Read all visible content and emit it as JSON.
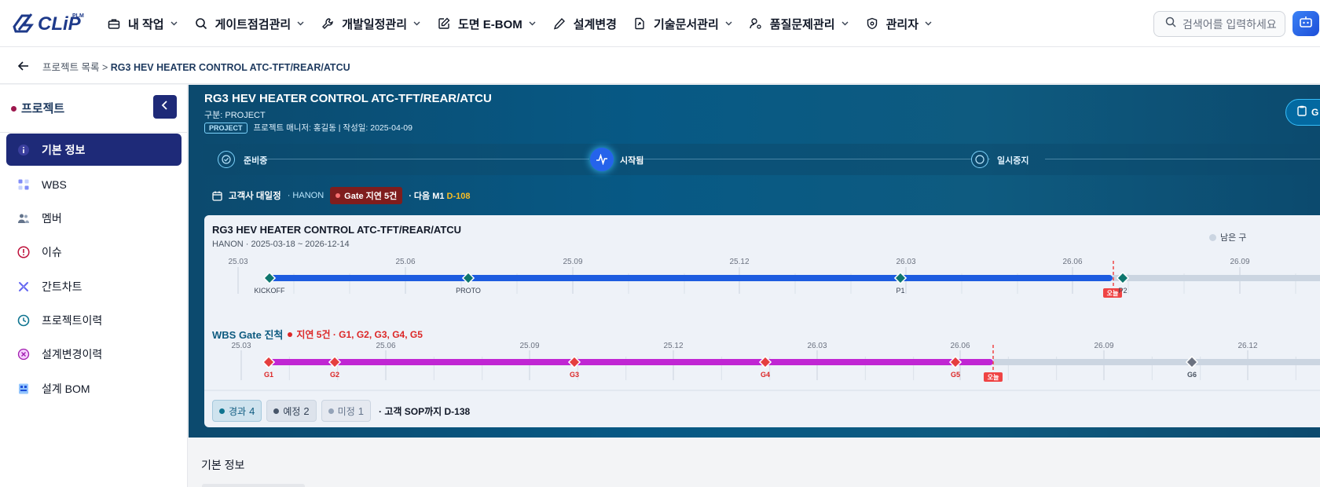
{
  "brand": {
    "logo_text": "CLiP",
    "logo_sub": "PLM"
  },
  "nav": {
    "items": [
      {
        "label": "내 작업",
        "icon": "briefcase-icon",
        "chevron": true
      },
      {
        "label": "게이트점검관리",
        "icon": "search-icon",
        "chevron": true
      },
      {
        "label": "개발일정관리",
        "icon": "wrench-icon",
        "chevron": true
      },
      {
        "label": "도면 E-BOM",
        "icon": "edit-icon",
        "chevron": true
      },
      {
        "label": "설계변경",
        "icon": "pen-icon",
        "chevron": false
      },
      {
        "label": "기술문서관리",
        "icon": "document-link-icon",
        "chevron": true
      },
      {
        "label": "품질문제관리",
        "icon": "user-settings-icon",
        "chevron": true
      },
      {
        "label": "관리자",
        "icon": "shield-gear-icon",
        "chevron": true
      }
    ],
    "search_placeholder": "검색어를 입력하세요"
  },
  "breadcrumb": {
    "parent": "프로젝트 목록",
    "separator": ">",
    "current": "RG3 HEV HEATER CONTROL ATC-TFT/REAR/ATCU"
  },
  "sidebar": {
    "title": "프로젝트",
    "items": [
      {
        "label": "기본 정보",
        "icon": "info-icon",
        "active": true
      },
      {
        "label": "WBS",
        "icon": "grid-icon",
        "active": false
      },
      {
        "label": "멤버",
        "icon": "users-icon",
        "active": false
      },
      {
        "label": "이슈",
        "icon": "alert-circle-icon",
        "active": false
      },
      {
        "label": "간트차트",
        "icon": "gantt-icon",
        "active": false
      },
      {
        "label": "프로젝트이력",
        "icon": "history-icon",
        "active": false
      },
      {
        "label": "설계변경이력",
        "icon": "change-history-icon",
        "active": false
      },
      {
        "label": "설계 BOM",
        "icon": "bom-icon",
        "active": false
      }
    ]
  },
  "project": {
    "title": "RG3 HEV HEATER CONTROL ATC-TFT/REAR/ATCU",
    "type_label": "구분:",
    "type_value": "PROJECT",
    "badge": "PROJECT",
    "meta": "프로젝트 매니저: 홍길동 | 작성일: 2025-04-09",
    "right_button": "G"
  },
  "status_steps": [
    {
      "label": "준비중",
      "state": "done"
    },
    {
      "label": "시작됨",
      "state": "current"
    },
    {
      "label": "일시중지",
      "state": "pending"
    }
  ],
  "customer_schedule": {
    "title": "고객사 대일정",
    "customer": "· HANON",
    "gate_delay": "Gate 지연 5건",
    "next_prefix": "· 다음 M1",
    "next_dday": "D-108"
  },
  "gantt": {
    "title": "RG3 HEV HEATER CONTROL ATC-TFT/REAR/ATCU",
    "subtitle": "HANON · 2025-03-18 ~ 2026-12-14",
    "legend_remaining": "남은 구",
    "today_label": "오늘",
    "top_ticks": [
      "25.03",
      "25.06",
      "25.09",
      "25.12",
      "26.03",
      "26.06",
      "26.09"
    ],
    "milestones": [
      "KICKOFF",
      "PROTO",
      "P1",
      "P2"
    ],
    "wbs_title": "WBS Gate 진척",
    "wbs_late": "지연 5건 · G1, G2, G3, G4, G5",
    "wbs_ticks": [
      "25.03",
      "25.06",
      "25.09",
      "25.12",
      "26.03",
      "26.06",
      "26.09",
      "26.12"
    ],
    "gates": [
      "G1",
      "G2",
      "G3",
      "G4",
      "G5",
      "G6"
    ]
  },
  "counts": [
    {
      "label": "경과",
      "value": "4",
      "color": "#0e7490"
    },
    {
      "label": "예정",
      "value": "2",
      "color": "#475569"
    },
    {
      "label": "미정",
      "value": "1",
      "color": "#94a3b8"
    }
  ],
  "sop_text": "· 고객 SOP까지 D-138",
  "section_title": "기본 정보",
  "colors": {
    "navy": "#1e2a78",
    "hero": "#075985",
    "bar_blue": "#1d5ce0",
    "bar_magenta": "#c026d3",
    "milestone_green": "#0f766e",
    "gate_red": "#dc2626",
    "today_red": "#ef4444"
  }
}
